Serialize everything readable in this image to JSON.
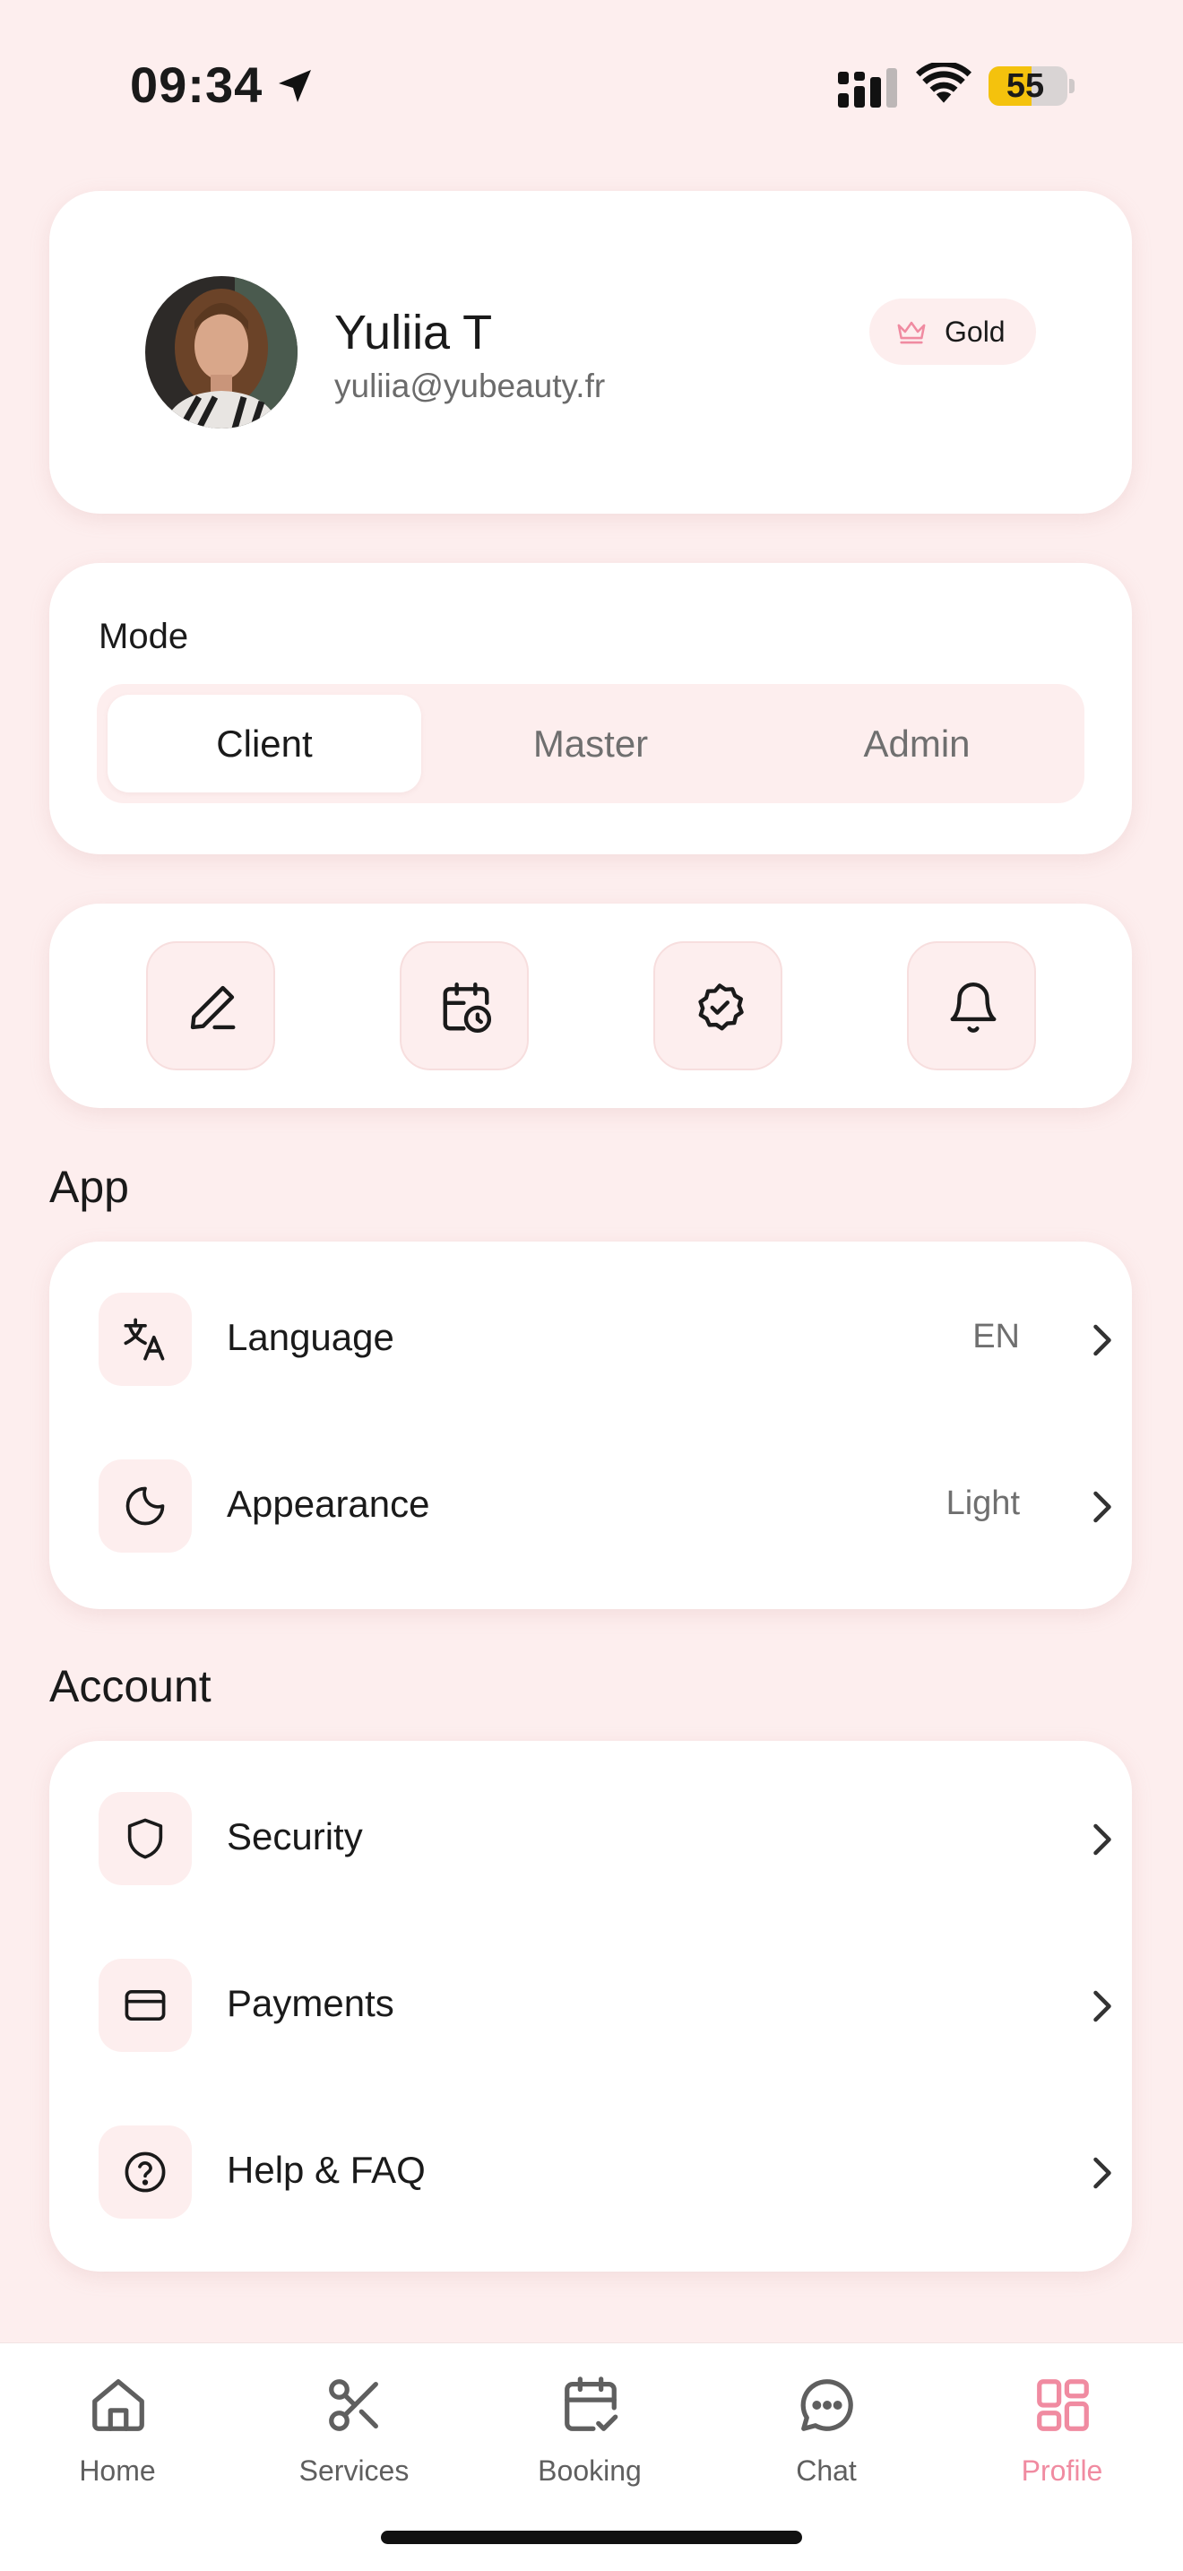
{
  "status_bar": {
    "time": "09:34",
    "battery": "55",
    "battery_percent": 55
  },
  "profile": {
    "name": "Yuliia T",
    "email": "yuliia@yubeauty.fr",
    "tier": "Gold"
  },
  "mode": {
    "title": "Mode",
    "options": [
      "Client",
      "Master",
      "Admin"
    ],
    "selected": "Client"
  },
  "quick_actions": [
    {
      "icon": "edit-icon"
    },
    {
      "icon": "calendar-clock-icon"
    },
    {
      "icon": "badge-check-icon"
    },
    {
      "icon": "bell-icon"
    }
  ],
  "app_section": {
    "title": "App",
    "items": [
      {
        "label": "Language",
        "value": "EN",
        "icon": "translate-icon"
      },
      {
        "label": "Appearance",
        "value": "Light",
        "icon": "moon-icon"
      }
    ]
  },
  "account_section": {
    "title": "Account",
    "items": [
      {
        "label": "Security",
        "icon": "shield-icon"
      },
      {
        "label": "Payments",
        "icon": "credit-card-icon"
      },
      {
        "label": "Help & FAQ",
        "icon": "help-circle-icon"
      }
    ]
  },
  "tab_bar": {
    "tabs": [
      {
        "label": "Home",
        "icon": "home-icon"
      },
      {
        "label": "Services",
        "icon": "scissors-icon"
      },
      {
        "label": "Booking",
        "icon": "calendar-check-icon"
      },
      {
        "label": "Chat",
        "icon": "chat-icon"
      },
      {
        "label": "Profile",
        "icon": "grid-icon"
      }
    ],
    "active": "Profile"
  },
  "colors": {
    "background": "#fdeeee",
    "accent": "#f08ba1",
    "battery": "#f4c20d"
  }
}
